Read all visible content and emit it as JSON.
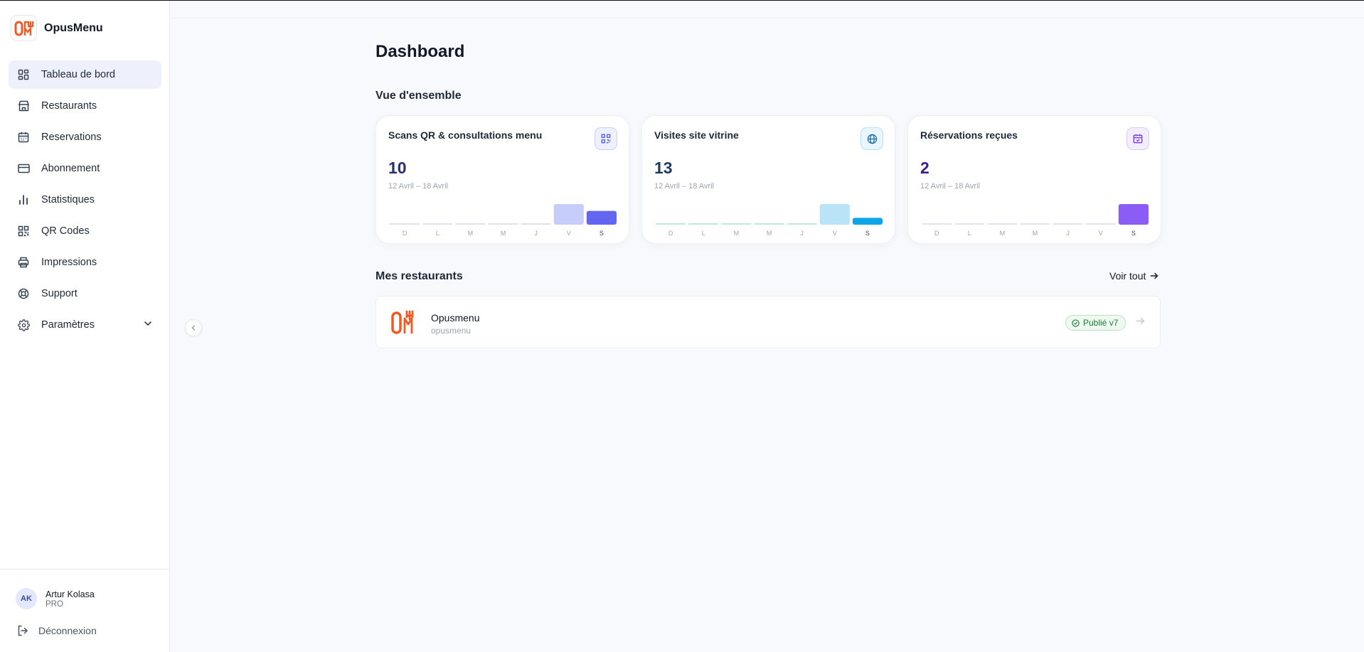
{
  "brand": {
    "name": "OpusMenu",
    "logo_text": "OM"
  },
  "sidebar": {
    "items": [
      {
        "label": "Tableau de bord",
        "icon": "dashboard-grid-icon",
        "active": true
      },
      {
        "label": "Restaurants",
        "icon": "store-icon"
      },
      {
        "label": "Reservations",
        "icon": "calendar-icon"
      },
      {
        "label": "Abonnement",
        "icon": "credit-card-icon"
      },
      {
        "label": "Statistiques",
        "icon": "bar-chart-icon"
      },
      {
        "label": "QR Codes",
        "icon": "qr-code-icon"
      },
      {
        "label": "Impressions",
        "icon": "printer-icon"
      },
      {
        "label": "Support",
        "icon": "lifebuoy-icon"
      },
      {
        "label": "Paramètres",
        "icon": "gear-icon",
        "expandable": true
      }
    ]
  },
  "user": {
    "initials": "AK",
    "name": "Artur Kolasa",
    "plan": "PRO"
  },
  "logout_label": "Déconnexion",
  "page": {
    "title": "Dashboard"
  },
  "overview": {
    "title": "Vue d'ensemble",
    "cards": [
      {
        "title": "Scans QR & consultations menu",
        "value": "10",
        "range": "12 Avril – 18 Avril",
        "icon": "qr-code-icon",
        "value_color": "#27306b",
        "accent": "#6366f1",
        "light": "#c7cdfb",
        "base": "#dde2f3",
        "icon_bg": "#eef0fd",
        "days": [
          "D",
          "L",
          "M",
          "M",
          "J",
          "V",
          "S"
        ],
        "values": [
          0,
          0,
          0,
          0,
          0,
          6,
          4
        ],
        "highlight_index": 6
      },
      {
        "title": "Visites site vitrine",
        "value": "13",
        "range": "12 Avril – 18 Avril",
        "icon": "globe-icon",
        "value_color": "#1e3a5f",
        "accent": "#0ea5e9",
        "light": "#b9e3f7",
        "base": "#bfe8e2",
        "icon_bg": "#e9f6fd",
        "days": [
          "D",
          "L",
          "M",
          "M",
          "J",
          "V",
          "S"
        ],
        "values": [
          0,
          0,
          0,
          0,
          0,
          6,
          2
        ],
        "highlight_index": 6
      },
      {
        "title": "Réservations reçues",
        "value": "2",
        "range": "12 Avril – 18 Avril",
        "icon": "calendar-icon",
        "value_color": "#3b1e87",
        "accent": "#8b5cf6",
        "light": "#dccdfb",
        "base": "#e5e0f3",
        "icon_bg": "#f3eefd",
        "days": [
          "D",
          "L",
          "M",
          "M",
          "J",
          "V",
          "S"
        ],
        "values": [
          0,
          0,
          0,
          0,
          0,
          0,
          2
        ],
        "highlight_index": 6
      }
    ]
  },
  "restaurants": {
    "title": "Mes restaurants",
    "see_all": "Voir tout",
    "items": [
      {
        "name": "Opusmenu",
        "slug": "opusmenu",
        "status": "Publié v7"
      }
    ]
  }
}
